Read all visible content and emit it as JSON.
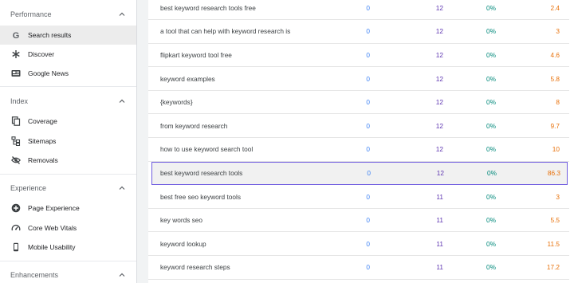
{
  "sidebar": {
    "sections": [
      {
        "title": "Performance",
        "items": [
          {
            "label": "Search results",
            "icon": "google-g-icon",
            "active": true
          },
          {
            "label": "Discover",
            "icon": "asterisk-icon"
          },
          {
            "label": "Google News",
            "icon": "news-icon"
          }
        ]
      },
      {
        "title": "Index",
        "items": [
          {
            "label": "Coverage",
            "icon": "copy-icon"
          },
          {
            "label": "Sitemaps",
            "icon": "sitemap-icon"
          },
          {
            "label": "Removals",
            "icon": "eye-off-icon"
          }
        ]
      },
      {
        "title": "Experience",
        "items": [
          {
            "label": "Page Experience",
            "icon": "plus-circle-icon"
          },
          {
            "label": "Core Web Vitals",
            "icon": "gauge-icon"
          },
          {
            "label": "Mobile Usability",
            "icon": "phone-icon"
          }
        ]
      },
      {
        "title": "Enhancements",
        "items": []
      }
    ]
  },
  "table": {
    "rows": [
      {
        "query": "best keyword research tools free",
        "clicks": "0",
        "impressions": "12",
        "ctr": "0%",
        "position": "2.4"
      },
      {
        "query": "a tool that can help with keyword research is",
        "clicks": "0",
        "impressions": "12",
        "ctr": "0%",
        "position": "3"
      },
      {
        "query": "flipkart keyword tool free",
        "clicks": "0",
        "impressions": "12",
        "ctr": "0%",
        "position": "4.6"
      },
      {
        "query": "keyword examples",
        "clicks": "0",
        "impressions": "12",
        "ctr": "0%",
        "position": "5.8"
      },
      {
        "query": "{keywords}",
        "clicks": "0",
        "impressions": "12",
        "ctr": "0%",
        "position": "8"
      },
      {
        "query": "from keyword research",
        "clicks": "0",
        "impressions": "12",
        "ctr": "0%",
        "position": "9.7"
      },
      {
        "query": "how to use keyword search tool",
        "clicks": "0",
        "impressions": "12",
        "ctr": "0%",
        "position": "10"
      },
      {
        "query": "best keyword research tools",
        "clicks": "0",
        "impressions": "12",
        "ctr": "0%",
        "position": "86.3",
        "highlighted": true
      },
      {
        "query": "best free seo keyword tools",
        "clicks": "0",
        "impressions": "11",
        "ctr": "0%",
        "position": "3"
      },
      {
        "query": "key words seo",
        "clicks": "0",
        "impressions": "11",
        "ctr": "0%",
        "position": "5.5"
      },
      {
        "query": "keyword lookup",
        "clicks": "0",
        "impressions": "11",
        "ctr": "0%",
        "position": "11.5"
      },
      {
        "query": "keyword research steps",
        "clicks": "0",
        "impressions": "11",
        "ctr": "0%",
        "position": "17.2"
      }
    ]
  }
}
